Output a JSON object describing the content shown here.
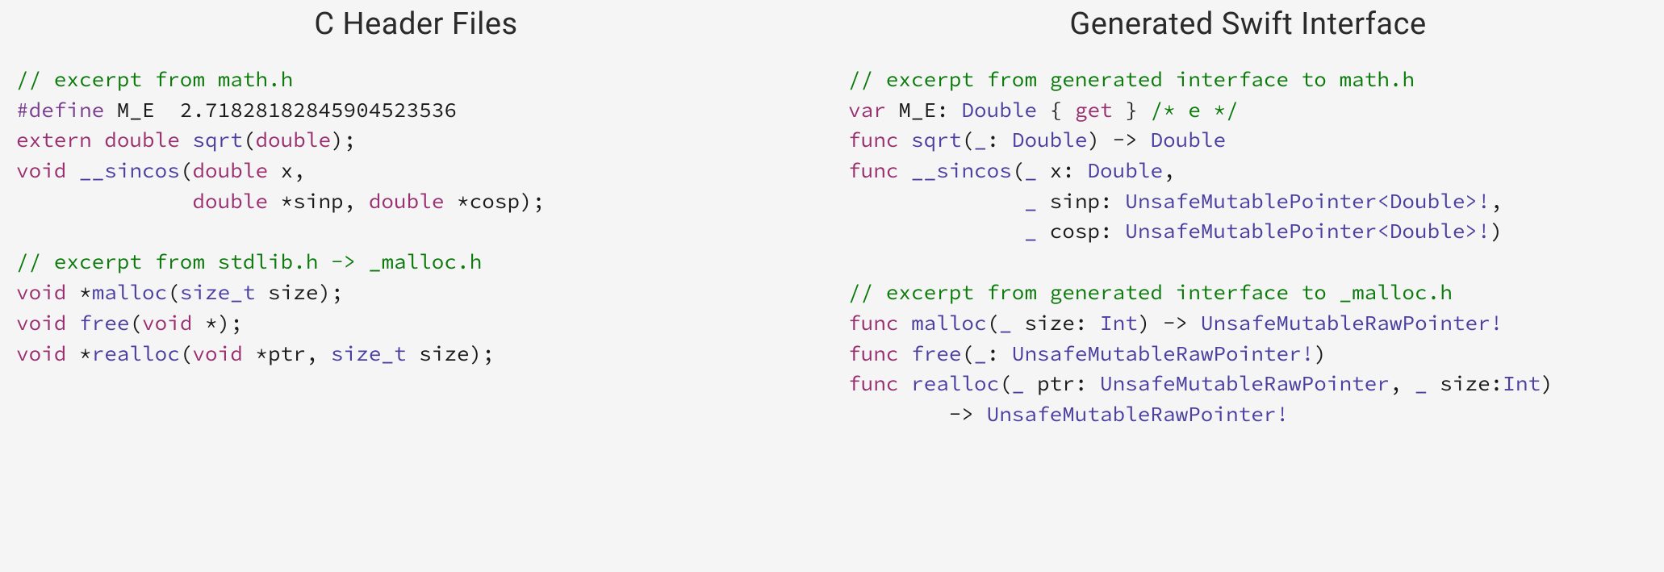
{
  "left": {
    "title": "C Header Files",
    "blocks": [
      {
        "lines": [
          [
            {
              "cls": "tok-comment",
              "text": "// excerpt from math.h"
            }
          ],
          [
            {
              "cls": "tok-macro",
              "text": "#define"
            },
            {
              "cls": "tok-ident",
              "text": " M_E  "
            },
            {
              "cls": "tok-number",
              "text": "2.71828182845904523536"
            }
          ],
          [
            {
              "cls": "tok-keyword",
              "text": "extern"
            },
            {
              "cls": "tok-ident",
              "text": " "
            },
            {
              "cls": "tok-keyword",
              "text": "double"
            },
            {
              "cls": "tok-ident",
              "text": " "
            },
            {
              "cls": "tok-func",
              "text": "sqrt"
            },
            {
              "cls": "tok-punct",
              "text": "("
            },
            {
              "cls": "tok-keyword",
              "text": "double"
            },
            {
              "cls": "tok-punct",
              "text": ");"
            }
          ],
          [
            {
              "cls": "tok-keyword",
              "text": "void"
            },
            {
              "cls": "tok-ident",
              "text": " "
            },
            {
              "cls": "tok-func",
              "text": "__sincos"
            },
            {
              "cls": "tok-punct",
              "text": "("
            },
            {
              "cls": "tok-keyword",
              "text": "double"
            },
            {
              "cls": "tok-ident",
              "text": " x,"
            }
          ],
          [
            {
              "cls": "tok-ident",
              "text": "              "
            },
            {
              "cls": "tok-keyword",
              "text": "double"
            },
            {
              "cls": "tok-ident",
              "text": " *sinp, "
            },
            {
              "cls": "tok-keyword",
              "text": "double"
            },
            {
              "cls": "tok-ident",
              "text": " *cosp);"
            }
          ]
        ]
      },
      {
        "lines": [
          [
            {
              "cls": "tok-comment",
              "text": "// excerpt from stdlib.h -> _malloc.h"
            }
          ],
          [
            {
              "cls": "tok-keyword",
              "text": "void"
            },
            {
              "cls": "tok-ident",
              "text": " *"
            },
            {
              "cls": "tok-func",
              "text": "malloc"
            },
            {
              "cls": "tok-punct",
              "text": "("
            },
            {
              "cls": "tok-type",
              "text": "size_t"
            },
            {
              "cls": "tok-ident",
              "text": " size);"
            }
          ],
          [
            {
              "cls": "tok-keyword",
              "text": "void"
            },
            {
              "cls": "tok-ident",
              "text": " "
            },
            {
              "cls": "tok-func",
              "text": "free"
            },
            {
              "cls": "tok-punct",
              "text": "("
            },
            {
              "cls": "tok-keyword",
              "text": "void"
            },
            {
              "cls": "tok-ident",
              "text": " *);"
            }
          ],
          [
            {
              "cls": "tok-keyword",
              "text": "void"
            },
            {
              "cls": "tok-ident",
              "text": " *"
            },
            {
              "cls": "tok-func",
              "text": "realloc"
            },
            {
              "cls": "tok-punct",
              "text": "("
            },
            {
              "cls": "tok-keyword",
              "text": "void"
            },
            {
              "cls": "tok-ident",
              "text": " *ptr, "
            },
            {
              "cls": "tok-type",
              "text": "size_t"
            },
            {
              "cls": "tok-ident",
              "text": " size);"
            }
          ]
        ]
      }
    ]
  },
  "right": {
    "title": "Generated Swift Interface",
    "blocks": [
      {
        "lines": [
          [
            {
              "cls": "tok-comment",
              "text": "// excerpt from generated interface to math.h"
            }
          ],
          [
            {
              "cls": "tok-keyword",
              "text": "var"
            },
            {
              "cls": "tok-ident",
              "text": " M_E: "
            },
            {
              "cls": "tok-type",
              "text": "Double"
            },
            {
              "cls": "tok-ident",
              "text": " { "
            },
            {
              "cls": "tok-keyword",
              "text": "get"
            },
            {
              "cls": "tok-ident",
              "text": " } "
            },
            {
              "cls": "tok-comment",
              "text": "/* e */"
            }
          ],
          [
            {
              "cls": "tok-keyword",
              "text": "func"
            },
            {
              "cls": "tok-ident",
              "text": " "
            },
            {
              "cls": "tok-func",
              "text": "sqrt"
            },
            {
              "cls": "tok-punct",
              "text": "("
            },
            {
              "cls": "tok-underscore",
              "text": "_"
            },
            {
              "cls": "tok-ident",
              "text": ": "
            },
            {
              "cls": "tok-type",
              "text": "Double"
            },
            {
              "cls": "tok-punct",
              "text": ") -> "
            },
            {
              "cls": "tok-type",
              "text": "Double"
            }
          ],
          [
            {
              "cls": "tok-keyword",
              "text": "func"
            },
            {
              "cls": "tok-ident",
              "text": " "
            },
            {
              "cls": "tok-func",
              "text": "__sincos"
            },
            {
              "cls": "tok-punct",
              "text": "("
            },
            {
              "cls": "tok-underscore",
              "text": "_"
            },
            {
              "cls": "tok-ident",
              "text": " x: "
            },
            {
              "cls": "tok-type",
              "text": "Double"
            },
            {
              "cls": "tok-punct",
              "text": ","
            }
          ],
          [
            {
              "cls": "tok-ident",
              "text": "              "
            },
            {
              "cls": "tok-underscore",
              "text": "_"
            },
            {
              "cls": "tok-ident",
              "text": " sinp: "
            },
            {
              "cls": "tok-type",
              "text": "UnsafeMutablePointer<Double>!"
            },
            {
              "cls": "tok-punct",
              "text": ","
            }
          ],
          [
            {
              "cls": "tok-ident",
              "text": "              "
            },
            {
              "cls": "tok-underscore",
              "text": "_"
            },
            {
              "cls": "tok-ident",
              "text": " cosp: "
            },
            {
              "cls": "tok-type",
              "text": "UnsafeMutablePointer<Double>!"
            },
            {
              "cls": "tok-punct",
              "text": ")"
            }
          ]
        ]
      },
      {
        "lines": [
          [
            {
              "cls": "tok-comment",
              "text": "// excerpt from generated interface to _malloc.h"
            }
          ],
          [
            {
              "cls": "tok-keyword",
              "text": "func"
            },
            {
              "cls": "tok-ident",
              "text": " "
            },
            {
              "cls": "tok-func",
              "text": "malloc"
            },
            {
              "cls": "tok-punct",
              "text": "("
            },
            {
              "cls": "tok-underscore",
              "text": "_"
            },
            {
              "cls": "tok-ident",
              "text": " size: "
            },
            {
              "cls": "tok-type",
              "text": "Int"
            },
            {
              "cls": "tok-punct",
              "text": ") -> "
            },
            {
              "cls": "tok-type",
              "text": "UnsafeMutableRawPointer!"
            }
          ],
          [
            {
              "cls": "tok-keyword",
              "text": "func"
            },
            {
              "cls": "tok-ident",
              "text": " "
            },
            {
              "cls": "tok-func",
              "text": "free"
            },
            {
              "cls": "tok-punct",
              "text": "("
            },
            {
              "cls": "tok-underscore",
              "text": "_"
            },
            {
              "cls": "tok-ident",
              "text": ": "
            },
            {
              "cls": "tok-type",
              "text": "UnsafeMutableRawPointer!"
            },
            {
              "cls": "tok-punct",
              "text": ")"
            }
          ],
          [
            {
              "cls": "tok-keyword",
              "text": "func"
            },
            {
              "cls": "tok-ident",
              "text": " "
            },
            {
              "cls": "tok-func",
              "text": "realloc"
            },
            {
              "cls": "tok-punct",
              "text": "("
            },
            {
              "cls": "tok-underscore",
              "text": "_"
            },
            {
              "cls": "tok-ident",
              "text": " ptr: "
            },
            {
              "cls": "tok-type",
              "text": "UnsafeMutableRawPointer"
            },
            {
              "cls": "tok-punct",
              "text": ", "
            },
            {
              "cls": "tok-underscore",
              "text": "_"
            },
            {
              "cls": "tok-ident",
              "text": " size:"
            },
            {
              "cls": "tok-type",
              "text": "Int"
            },
            {
              "cls": "tok-punct",
              "text": ")"
            }
          ],
          [
            {
              "cls": "tok-ident",
              "text": "        -> "
            },
            {
              "cls": "tok-type",
              "text": "UnsafeMutableRawPointer!"
            }
          ]
        ]
      }
    ]
  }
}
